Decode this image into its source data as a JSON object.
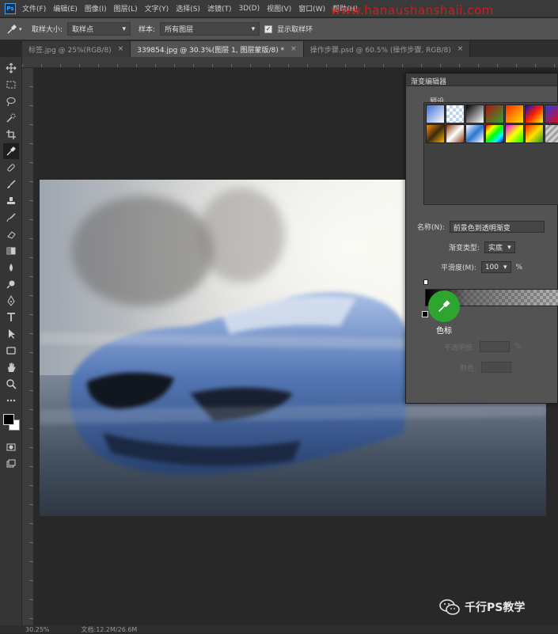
{
  "app": {
    "logo": "Ps"
  },
  "menubar": {
    "items": [
      "文件(F)",
      "编辑(E)",
      "图像(I)",
      "图层(L)",
      "文字(Y)",
      "选择(S)",
      "滤镜(T)",
      "3D(D)",
      "视图(V)",
      "窗口(W)",
      "帮助(H)"
    ],
    "watermark": "www.hanaushanshaii.com"
  },
  "options": {
    "sample_size_label": "取样大小:",
    "sample_size_value": "取样点",
    "sample_label": "样本:",
    "sample_value": "所有图层",
    "show_ring_checked": true,
    "show_ring_label": "显示取样环"
  },
  "tabs": [
    {
      "label": "标签.jpg @ 25%(RGB/8)",
      "active": false
    },
    {
      "label": "339854.jpg @ 30.3%(图层 1, 图层蒙版/8) *",
      "active": true
    },
    {
      "label": "操作步骤.psd @ 60.5% (操作步骤, RGB/8)",
      "active": false
    }
  ],
  "gradient_editor": {
    "title": "渐变编辑器",
    "presets_label": "预设",
    "presets": [
      "linear-gradient(135deg,#3b6fd8,#ffffff)",
      "repeating-conic-gradient(#bcd5f5 0% 25%,#ffffff 0% 50%)",
      "linear-gradient(135deg,#000000,#ffffff)",
      "linear-gradient(135deg,#b01414,#2fa52f)",
      "linear-gradient(135deg,#ff2a00,#ffe100)",
      "linear-gradient(135deg,#1010c0,#ff2000,#ffff00)",
      "linear-gradient(135deg,#2040e0,#ff0000)",
      "linear-gradient(135deg,#ff8a00,#3a2a10,#ffb000)",
      "linear-gradient(135deg,#8a3a10,#ffffff,#8a3a10)",
      "linear-gradient(135deg,#ffffff,#2a74d0,#ffffff)",
      "linear-gradient(135deg,#ff0000,#ffff00,#00ff00,#00ffff,#0000ff)",
      "linear-gradient(135deg,#ff00ff,#ffff00,#00ff00)",
      "linear-gradient(135deg,#ff2000,#ffe000,#20a020)",
      "repeating-linear-gradient(135deg,#cfcfcf 0 3px,#9f9f9f 3px 6px)"
    ],
    "name_label": "名称(N):",
    "name_value": "前景色到透明渐变",
    "type_label": "渐变类型:",
    "type_value": "实底",
    "smoothness_label": "平滑度(M):",
    "smoothness_value": "100",
    "smoothness_unit": "%",
    "color_stop_callout": "色标",
    "opacity_label": "不透明度:",
    "opacity_unit": "%",
    "color_label": "颜色:"
  },
  "status": {
    "zoom": "30.25%",
    "doc": "文档:12.2M/26.6M"
  },
  "brand": {
    "name": "千行PS教学"
  }
}
